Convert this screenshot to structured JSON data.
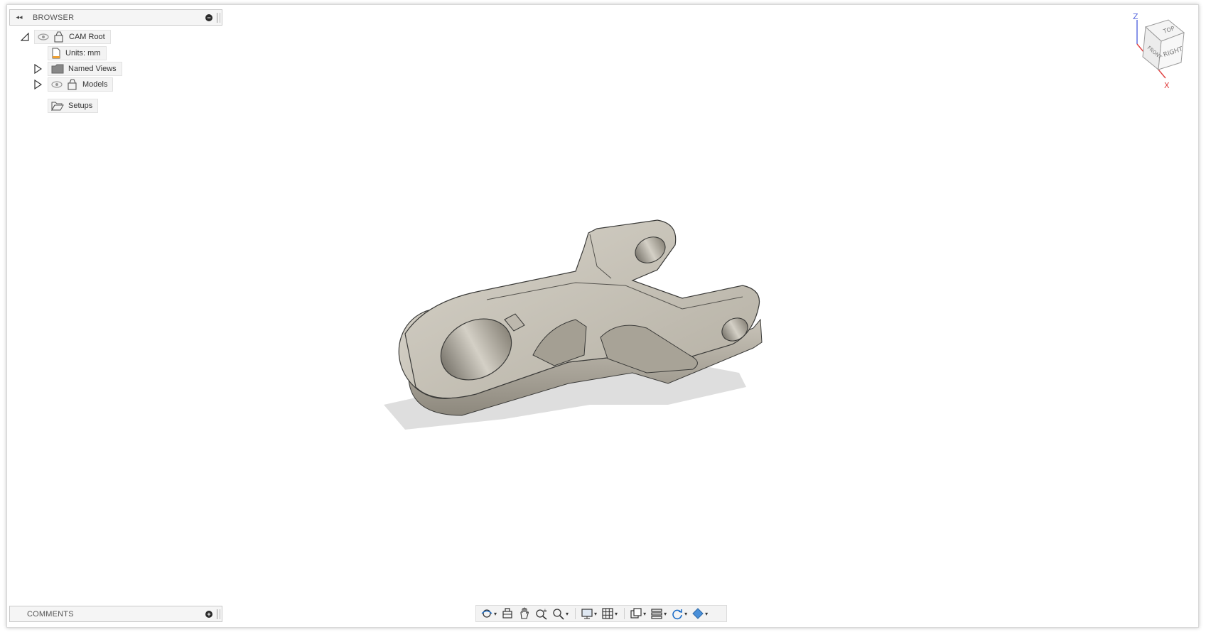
{
  "browser": {
    "title": "BROWSER",
    "nodes": [
      {
        "label": "CAM Root"
      },
      {
        "label": "Units: mm"
      },
      {
        "label": "Named Views"
      },
      {
        "label": "Models"
      },
      {
        "label": "Setups"
      }
    ]
  },
  "comments": {
    "title": "COMMENTS"
  },
  "viewcube": {
    "faces": [
      "TOP",
      "FRONT",
      "RIGHT"
    ],
    "axes": {
      "z": "Z",
      "x": "X"
    },
    "colors": {
      "z": "#5566dd",
      "x": "#e04040"
    }
  },
  "toolbar": {
    "buttons": [
      {
        "icon": "orbit-icon"
      },
      {
        "icon": "look-at-icon"
      },
      {
        "icon": "pan-icon"
      },
      {
        "icon": "zoom-icon"
      },
      {
        "icon": "fit-icon"
      },
      {
        "icon": "display-settings-icon"
      },
      {
        "icon": "grid-settings-icon"
      },
      {
        "icon": "viewports-icon"
      },
      {
        "icon": "layers-icon"
      },
      {
        "icon": "refresh-icon"
      },
      {
        "icon": "cam-stock-icon"
      }
    ]
  },
  "colors": {
    "part_body": "#b9b4a8",
    "part_edge": "#3a3a38",
    "shadow": "#dcdcdc"
  }
}
